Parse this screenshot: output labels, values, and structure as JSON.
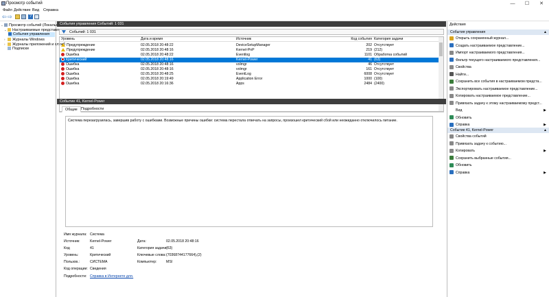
{
  "window": {
    "title": "Просмотр событий",
    "buttons": [
      "—",
      "☐",
      "✕"
    ]
  },
  "menu": [
    "Файл",
    "Действие",
    "Вид",
    "Справка"
  ],
  "tree": [
    {
      "label": "Просмотр событий (Локальный)",
      "indent": 0,
      "arrow": "⌄"
    },
    {
      "label": "Настраиваемые представления",
      "indent": 1,
      "arrow": "⌄"
    },
    {
      "label": "События управления",
      "indent": 2,
      "arrow": "",
      "selected": true
    },
    {
      "label": "Журналы Windows",
      "indent": 1,
      "arrow": "›"
    },
    {
      "label": "Журналы приложений и служб",
      "indent": 1,
      "arrow": "›"
    },
    {
      "label": "Подписки",
      "indent": 1,
      "arrow": ""
    }
  ],
  "center": {
    "header": "События управления    Событий: 1 031",
    "count": "Событий: 1 031",
    "columns": [
      "Уровень",
      "Дата и время",
      "Источник",
      "Код события",
      "Категория задачи"
    ],
    "rows": [
      {
        "level": "Предупреждение",
        "icon": "warn",
        "date": "02.05.2018 20:48:22",
        "source": "DeviceSetupManager",
        "code": "202",
        "cat": "Отсутствует"
      },
      {
        "level": "Предупреждение",
        "icon": "warn",
        "date": "02.05.2018 20:48:16",
        "source": "Kernel-PnP",
        "code": "219",
        "cat": "(212)"
      },
      {
        "level": "Ошибка",
        "icon": "err",
        "date": "02.05.2018 20:48:22",
        "source": "Eventlog",
        "code": "1101",
        "cat": "Обработка событий"
      },
      {
        "level": "Критический",
        "icon": "crit",
        "date": "02.05.2018 20:48:16",
        "source": "Kernel-Power",
        "code": "41",
        "cat": "(63)",
        "selected": true
      },
      {
        "level": "Ошибка",
        "icon": "err",
        "date": "02.05.2018 20:48:16",
        "source": "volmgr",
        "code": "46",
        "cat": "Отсутствует"
      },
      {
        "level": "Ошибка",
        "icon": "err",
        "date": "02.05.2018 20:48:16",
        "source": "volmgr",
        "code": "161",
        "cat": "Отсутствует"
      },
      {
        "level": "Ошибка",
        "icon": "err",
        "date": "02.05.2018 20:48:25",
        "source": "EventLog",
        "code": "6008",
        "cat": "Отсутствует"
      },
      {
        "level": "Ошибка",
        "icon": "err",
        "date": "02.05.2018 20:19:49",
        "source": "Application Error",
        "code": "1000",
        "cat": "(100)"
      },
      {
        "level": "Ошибка",
        "icon": "err",
        "date": "02.05.2018 20:16:36",
        "source": "Apps",
        "code": "2484",
        "cat": "(2400)"
      }
    ],
    "detail_header": "Событие 41, Kernel-Power",
    "tabs": [
      "Общие",
      "Подробности"
    ],
    "message": "Система перезагрузилась, завершив работу с ошибками. Возможные причины ошибки: система перестала отвечать на запросы, произошел критический сбой или неожиданно отключилось питание.",
    "props": {
      "log_label": "Имя журнала:",
      "log": "Система",
      "source_label": "Источник:",
      "source": "Kernel-Power",
      "date_label": "Дата:",
      "date": "02.05.2018 20:48:16",
      "code_label": "Код",
      "code": "41",
      "cat_label": "Категория задачи:",
      "cat": "(63)",
      "level_label": "Уровень:",
      "level": "Критический",
      "keywords_label": "Ключевые слова:",
      "keywords": "(70368744177664),(2)",
      "user_label": "Пользов.:",
      "user": "СИСТЕМА",
      "computer_label": "Компьютер:",
      "computer": "MSI",
      "opcode_label": "Код операции:",
      "opcode": "Сведения",
      "more_label": "Подробности:",
      "more": "Справка в Интернете для."
    }
  },
  "actions": {
    "title": "Действия",
    "section1": "События управления",
    "items1": [
      {
        "label": "Открыть сохраненный журнал...",
        "color": "#d9a520"
      },
      {
        "label": "Создать настраиваемое представление...",
        "color": "#2a6fbe"
      },
      {
        "label": "Импорт настраиваемого представления...",
        "color": "#888"
      },
      {
        "label": "Фильтр текущего настраиваемого представления...",
        "color": "#2a6fbe"
      },
      {
        "label": "Свойства",
        "color": "#888"
      },
      {
        "label": "Найти...",
        "color": "#555"
      },
      {
        "label": "Сохранить все события в настраиваемом предста...",
        "color": "#3a7c3a"
      },
      {
        "label": "Экспортировать настраиваемое представление...",
        "color": "#888"
      },
      {
        "label": "Копировать настраиваемое представление...",
        "color": "#888"
      },
      {
        "label": "Привязать задачу к этому настраиваемому предст...",
        "color": "#888"
      },
      {
        "label": "Вид",
        "color": "#fff",
        "sub": true
      },
      {
        "label": "Обновить",
        "color": "#2e8b57"
      },
      {
        "label": "Справка",
        "color": "#2a6fbe",
        "sub": true
      }
    ],
    "section2": "Событие 41, Kernel-Power",
    "items2": [
      {
        "label": "Свойства событий",
        "color": "#888"
      },
      {
        "label": "Привязать задачу к событию...",
        "color": "#888"
      },
      {
        "label": "Копировать",
        "color": "#888",
        "sub": true
      },
      {
        "label": "Сохранить выбранные события...",
        "color": "#3a7c3a"
      },
      {
        "label": "Обновить",
        "color": "#2e8b57"
      },
      {
        "label": "Справка",
        "color": "#2a6fbe",
        "sub": true
      }
    ]
  }
}
